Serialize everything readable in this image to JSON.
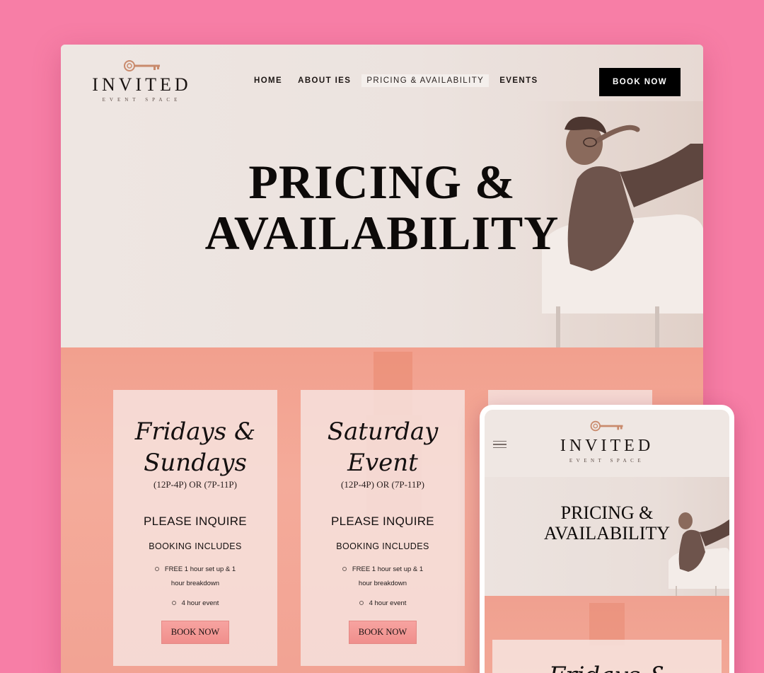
{
  "desktop": {
    "logo": {
      "wordmark": "INVITED",
      "tagline": "EVENT SPACE"
    },
    "nav": {
      "items": [
        {
          "label": "HOME",
          "active": false
        },
        {
          "label": "ABOUT IES",
          "active": false
        },
        {
          "label": "PRICING & AVAILABILITY",
          "active": true
        },
        {
          "label": "EVENTS",
          "active": false
        }
      ]
    },
    "book_now_label": "BOOK NOW",
    "hero": {
      "title_line1": "PRICING &",
      "title_line2": "AVAILABILITY"
    },
    "cards": [
      {
        "script_line1": "Fridays &",
        "script_line2": "Sundays",
        "hours": "(12P-4P) OR (7P-11P)",
        "price": "PLEASE INQUIRE",
        "includes_heading": "BOOKING INCLUDES",
        "includes": [
          "FREE 1 hour set up & 1 hour breakdown",
          "4 hour event"
        ],
        "button_label": "BOOK NOW"
      },
      {
        "script_line1": "Saturday",
        "script_line2": "Event",
        "hours": "(12P-4P) OR (7P-11P)",
        "price": "PLEASE INQUIRE",
        "includes_heading": "BOOKING INCLUDES",
        "includes": [
          "FREE 1 hour set up & 1 hour breakdown",
          "4 hour event"
        ],
        "button_label": "BOOK NOW"
      }
    ]
  },
  "mobile": {
    "logo": {
      "wordmark": "INVITED",
      "tagline": "EVENT SPACE"
    },
    "hero": {
      "title_line1": "PRICING &",
      "title_line2": "AVAILABILITY"
    },
    "card_script_partial": "Fridays &"
  },
  "colors": {
    "page_background": "#f77ea6",
    "hero_background": "#ede4e0",
    "band_background": "#f3a998",
    "button_dark": "#000000",
    "button_pink": "#f29896",
    "key_gold": "#c98a6c"
  }
}
